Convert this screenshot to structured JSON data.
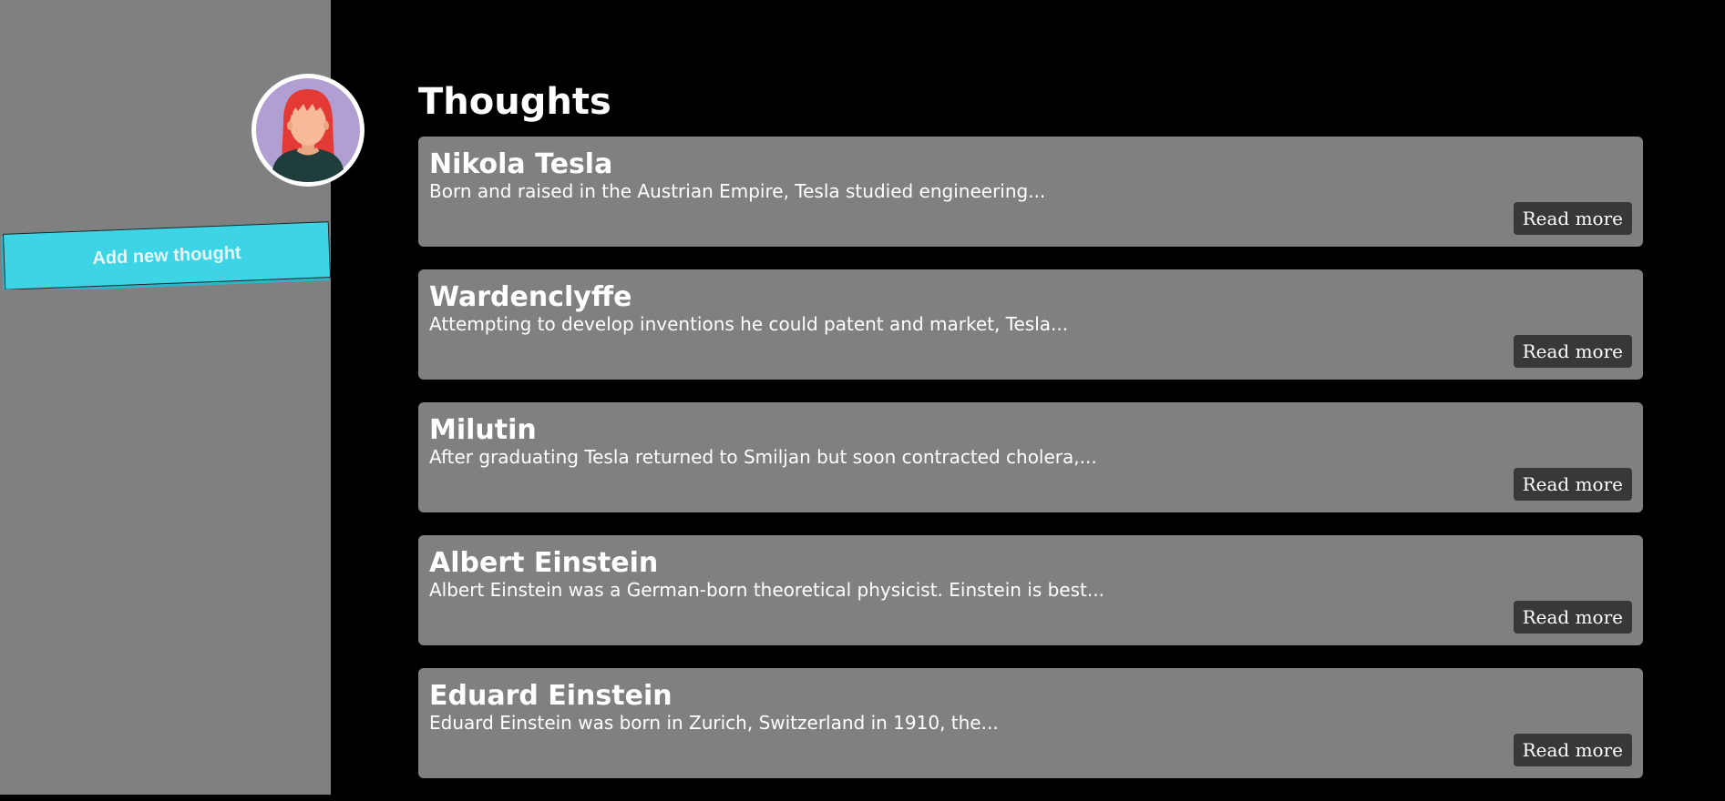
{
  "sidebar": {
    "add_button_label": "Add new thought",
    "avatar_icon": "user-avatar-red-hair"
  },
  "main": {
    "title": "Thoughts",
    "thoughts": [
      {
        "title": "Nikola Tesla",
        "excerpt": "Born and raised in the Austrian Empire, Tesla studied engineering...",
        "button_label": "Read more"
      },
      {
        "title": "Wardenclyffe",
        "excerpt": "Attempting to develop inventions he could patent and market, Tesla...",
        "button_label": "Read more"
      },
      {
        "title": "Milutin",
        "excerpt": "After graduating Tesla returned to Smiljan but soon contracted cholera,...",
        "button_label": "Read more"
      },
      {
        "title": "Albert Einstein",
        "excerpt": "Albert Einstein was a German-born theoretical physicist. Einstein is best...",
        "button_label": "Read more"
      },
      {
        "title": "Eduard Einstein",
        "excerpt": "Eduard Einstein was born in Zurich, Switzerland in 1910, the...",
        "button_label": "Read more"
      }
    ]
  },
  "colors": {
    "sidebar_bg": "#808080",
    "page_bg": "#000000",
    "card_bg": "#808080",
    "accent_button": "#3dd5e6",
    "read_more_bg": "#383838"
  }
}
